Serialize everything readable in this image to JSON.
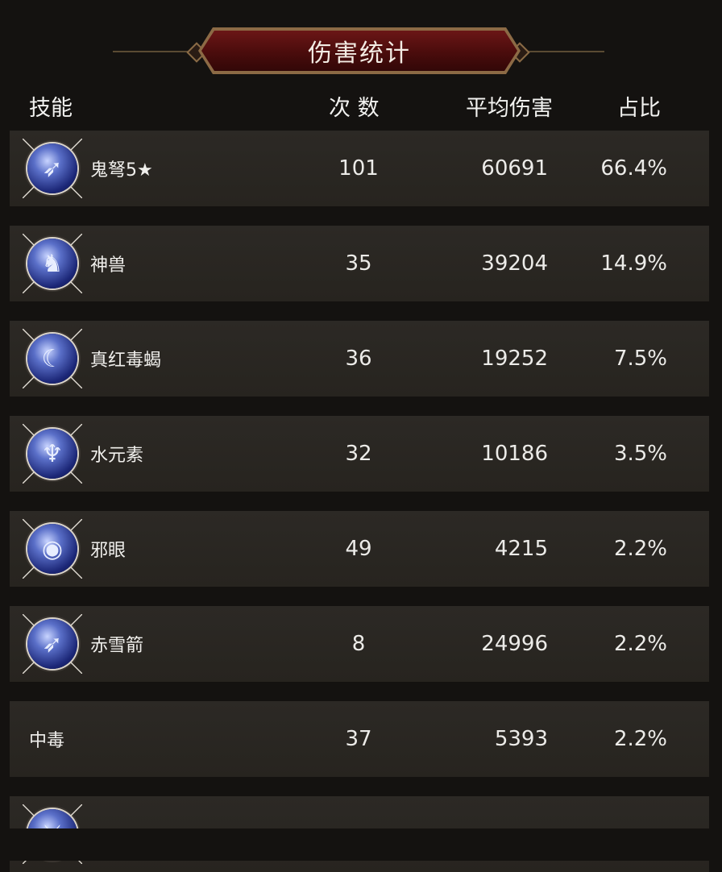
{
  "title": "伤害统计",
  "header": {
    "skill": "技能",
    "count": "次 数",
    "avg": "平均伤害",
    "pct": "占比"
  },
  "rows": [
    {
      "name": "鬼弩5★",
      "count": "101",
      "avg": "60691",
      "pct": "66.4%",
      "icon": "ghost-crossbow-icon",
      "glyph": "➶"
    },
    {
      "name": "神兽",
      "count": "35",
      "avg": "39204",
      "pct": "14.9%",
      "icon": "divine-beast-icon",
      "glyph": "♞"
    },
    {
      "name": "真红毒蝎",
      "count": "36",
      "avg": "19252",
      "pct": "7.5%",
      "icon": "scorpion-icon",
      "glyph": "☾"
    },
    {
      "name": "水元素",
      "count": "32",
      "avg": "10186",
      "pct": "3.5%",
      "icon": "water-elemental-icon",
      "glyph": "♆"
    },
    {
      "name": "邪眼",
      "count": "49",
      "avg": "4215",
      "pct": "2.2%",
      "icon": "evil-eye-icon",
      "glyph": "◉"
    },
    {
      "name": "赤雪箭",
      "count": "8",
      "avg": "24996",
      "pct": "2.2%",
      "icon": "red-snow-arrow-icon",
      "glyph": "➶"
    },
    {
      "name": "中毒",
      "count": "37",
      "avg": "5393",
      "pct": "2.2%",
      "icon": "",
      "glyph": ""
    },
    {
      "name": "",
      "count": "",
      "avg": "",
      "pct": "",
      "icon": "sword-skill-icon",
      "glyph": "⚔"
    }
  ]
}
